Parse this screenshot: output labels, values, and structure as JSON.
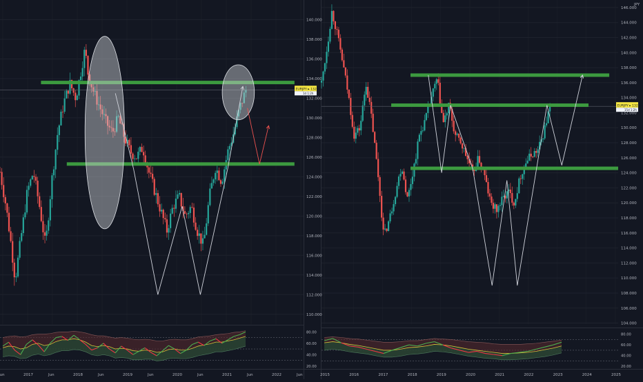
{
  "colors": {
    "background": "#131722",
    "grid": "#1e222d",
    "axis_text": "#b2b5be",
    "bull": "#26a69a",
    "bear": "#ef5350",
    "support_zone": "#3c9a3f",
    "pattern_line": "#d1d4dc",
    "ellipse_fill": "#cfd2d6",
    "price_badge": "#f5e642",
    "separator": "#2a2e39",
    "rsi_green": "#4caf50",
    "rsi_red": "#f23645",
    "rsi_ma_yellow": "#d9c23a",
    "band_fill_red": "#5a2a2e",
    "band_fill_green": "#1f4a33"
  },
  "chart_data": [
    {
      "type": "candlestick",
      "panel": "left",
      "currency_label": "",
      "y_ticks": [
        "140.000",
        "138.000",
        "136.000",
        "134.000",
        "132.000",
        "130.000",
        "128.000",
        "126.000",
        "124.000",
        "122.000",
        "120.000",
        "118.000",
        "116.000",
        "114.000",
        "112.000",
        "110.000"
      ],
      "x_ticks": [
        "Jun",
        "2017",
        "Jun",
        "2018",
        "Jun",
        "2019",
        "Jun",
        "2020",
        "Jun",
        "2021",
        "Jun",
        "2022",
        "Jun"
      ],
      "ylim": [
        109,
        142
      ],
      "price_label": {
        "text": "EURJPY ▸ 132.847",
        "sub": "1d 1:2h",
        "value": 132.85
      },
      "close_path": [
        [
          0.0,
          124.5
        ],
        [
          0.02,
          121.0
        ],
        [
          0.035,
          117.5
        ],
        [
          0.05,
          113.5
        ],
        [
          0.07,
          118.0
        ],
        [
          0.09,
          122.5
        ],
        [
          0.11,
          124.5
        ],
        [
          0.13,
          121.0
        ],
        [
          0.15,
          117.0
        ],
        [
          0.17,
          123.5
        ],
        [
          0.19,
          128.5
        ],
        [
          0.21,
          131.5
        ],
        [
          0.23,
          133.5
        ],
        [
          0.25,
          132.0
        ],
        [
          0.265,
          134.5
        ],
        [
          0.28,
          137.0
        ],
        [
          0.29,
          134.5
        ],
        [
          0.31,
          132.5
        ],
        [
          0.33,
          131.0
        ],
        [
          0.35,
          129.5
        ],
        [
          0.37,
          128.5
        ],
        [
          0.39,
          130.0
        ],
        [
          0.41,
          128.0
        ],
        [
          0.43,
          126.5
        ],
        [
          0.45,
          126.0
        ],
        [
          0.47,
          127.0
        ],
        [
          0.49,
          124.5
        ],
        [
          0.51,
          122.5
        ],
        [
          0.53,
          120.5
        ],
        [
          0.55,
          118.5
        ],
        [
          0.57,
          121.0
        ],
        [
          0.59,
          122.0
        ],
        [
          0.61,
          120.0
        ],
        [
          0.63,
          121.0
        ],
        [
          0.65,
          118.5
        ],
        [
          0.67,
          117.0
        ],
        [
          0.69,
          122.0
        ],
        [
          0.71,
          125.0
        ],
        [
          0.73,
          123.5
        ],
        [
          0.75,
          126.5
        ],
        [
          0.77,
          128.5
        ],
        [
          0.79,
          131.0
        ],
        [
          0.81,
          132.85
        ]
      ],
      "zones": [
        {
          "name": "resistance",
          "y": 133.6,
          "x0": 0.135,
          "x1": 0.97
        },
        {
          "name": "support",
          "y": 125.3,
          "x0": 0.22,
          "x1": 0.97
        }
      ],
      "w_pattern": [
        [
          0.38,
          132.5
        ],
        [
          0.44,
          124.8
        ],
        [
          0.52,
          112.0
        ],
        [
          0.6,
          121.0
        ],
        [
          0.66,
          112.0
        ],
        [
          0.75,
          124.8
        ],
        [
          0.8,
          133.2
        ]
      ],
      "projection": [
        [
          0.815,
          131.0
        ],
        [
          0.855,
          125.3
        ],
        [
          0.885,
          129.2
        ]
      ],
      "ellipses": [
        {
          "cx": 0.345,
          "cy": 128.5,
          "rx": 0.065,
          "ry": 9.8
        },
        {
          "cx": 0.785,
          "cy": 132.6,
          "rx": 0.053,
          "ry": 2.8
        }
      ]
    },
    {
      "type": "candlestick",
      "panel": "right",
      "currency_label": "JPY",
      "y_ticks": [
        "146.000",
        "144.000",
        "142.000",
        "140.000",
        "138.000",
        "136.000",
        "134.000",
        "132.000",
        "130.000",
        "128.000",
        "126.000",
        "124.000",
        "122.000",
        "120.000",
        "118.000",
        "116.000",
        "114.000",
        "112.000",
        "110.000",
        "108.000",
        "106.000",
        "104.000"
      ],
      "x_ticks": [
        "2015",
        "2016",
        "2017",
        "2018",
        "2019",
        "2020",
        "2021",
        "2022",
        "2023",
        "2024",
        "2025"
      ],
      "ylim": [
        103.5,
        147
      ],
      "price_label": {
        "text": "EURJPY ▸ 132.847",
        "sub": "15d 1:2h",
        "value": 132.85
      },
      "close_path": [
        [
          0.0,
          136.0
        ],
        [
          0.02,
          141.0
        ],
        [
          0.035,
          145.5
        ],
        [
          0.05,
          143.0
        ],
        [
          0.07,
          139.0
        ],
        [
          0.09,
          134.5
        ],
        [
          0.11,
          129.0
        ],
        [
          0.13,
          130.0
        ],
        [
          0.15,
          136.0
        ],
        [
          0.17,
          131.0
        ],
        [
          0.19,
          124.0
        ],
        [
          0.21,
          115.5
        ],
        [
          0.23,
          118.0
        ],
        [
          0.25,
          121.5
        ],
        [
          0.27,
          125.0
        ],
        [
          0.29,
          120.5
        ],
        [
          0.31,
          124.5
        ],
        [
          0.33,
          129.0
        ],
        [
          0.35,
          131.0
        ],
        [
          0.37,
          134.0
        ],
        [
          0.39,
          136.5
        ],
        [
          0.41,
          130.5
        ],
        [
          0.43,
          133.0
        ],
        [
          0.45,
          129.0
        ],
        [
          0.47,
          128.0
        ],
        [
          0.49,
          126.0
        ],
        [
          0.51,
          124.0
        ],
        [
          0.53,
          126.0
        ],
        [
          0.55,
          123.5
        ],
        [
          0.57,
          120.0
        ],
        [
          0.59,
          119.0
        ],
        [
          0.61,
          120.5
        ],
        [
          0.63,
          121.5
        ],
        [
          0.65,
          120.0
        ],
        [
          0.67,
          123.5
        ],
        [
          0.69,
          125.5
        ],
        [
          0.71,
          126.5
        ],
        [
          0.73,
          127.0
        ],
        [
          0.75,
          129.5
        ],
        [
          0.77,
          132.85
        ]
      ],
      "zones": [
        {
          "name": "upper-resistance",
          "y": 137.0,
          "x0": 0.3,
          "x1": 0.97
        },
        {
          "name": "resistance",
          "y": 133.0,
          "x0": 0.235,
          "x1": 0.9
        },
        {
          "name": "support",
          "y": 124.6,
          "x0": 0.3,
          "x1": 1.0
        }
      ],
      "w_pattern": [
        [
          0.36,
          137.0
        ],
        [
          0.405,
          124.0
        ],
        [
          0.435,
          133.0
        ],
        [
          0.51,
          124.5
        ],
        [
          0.575,
          109.0
        ],
        [
          0.625,
          123.0
        ],
        [
          0.66,
          109.0
        ],
        [
          0.76,
          133.0
        ],
        [
          0.81,
          125.0
        ],
        [
          0.88,
          137.0
        ]
      ]
    },
    {
      "type": "line",
      "panel": "left-rsi",
      "y_ticks": [
        "80.00",
        "60.00",
        "40.00",
        "20.00"
      ],
      "ylim": [
        15,
        90
      ],
      "levels": [
        70,
        50,
        30
      ],
      "rsi": [
        55,
        62,
        48,
        40,
        58,
        66,
        57,
        45,
        60,
        70,
        72,
        65,
        74,
        66,
        58,
        48,
        52,
        60,
        50,
        43,
        55,
        48,
        40,
        46,
        52,
        44,
        38,
        47,
        56,
        50,
        42,
        48,
        58,
        62,
        56,
        64,
        68,
        60,
        66,
        72,
        75,
        80
      ],
      "rsi_ma": [
        52,
        55,
        54,
        50,
        52,
        58,
        60,
        56,
        58,
        63,
        66,
        66,
        68,
        66,
        62,
        56,
        54,
        56,
        54,
        50,
        51,
        50,
        47,
        46,
        48,
        47,
        44,
        45,
        49,
        50,
        48,
        48,
        51,
        55,
        57,
        59,
        62,
        62,
        64,
        66,
        69,
        72
      ],
      "band_upper": [
        70,
        72,
        73,
        71,
        72,
        75,
        76,
        76,
        77,
        79,
        80,
        80,
        81,
        80,
        78,
        75,
        73,
        73,
        71,
        69,
        70,
        69,
        67,
        66,
        67,
        66,
        64,
        64,
        66,
        67,
        66,
        66,
        68,
        71,
        72,
        73,
        75,
        76,
        77,
        79,
        80,
        82
      ],
      "band_lower": [
        36,
        38,
        37,
        33,
        34,
        39,
        41,
        38,
        40,
        44,
        47,
        47,
        49,
        48,
        45,
        40,
        38,
        40,
        38,
        34,
        35,
        34,
        31,
        31,
        32,
        32,
        29,
        30,
        33,
        34,
        33,
        33,
        35,
        38,
        40,
        42,
        45,
        45,
        47,
        49,
        52,
        55
      ]
    },
    {
      "type": "line",
      "panel": "right-rsi",
      "y_ticks": [
        "80.00",
        "60.00",
        "40.00",
        "20.00"
      ],
      "ylim": [
        15,
        90
      ],
      "levels": [
        70,
        50,
        30
      ],
      "rsi": [
        68,
        72,
        64,
        58,
        56,
        52,
        48,
        44,
        50,
        55,
        60,
        58,
        63,
        66,
        60,
        54,
        50,
        46,
        48,
        44,
        42,
        40,
        44,
        46,
        48,
        52,
        56,
        60,
        65
      ],
      "rsi_ma": [
        64,
        66,
        64,
        61,
        59,
        56,
        53,
        50,
        50,
        52,
        55,
        56,
        58,
        61,
        60,
        58,
        55,
        52,
        50,
        48,
        46,
        44,
        44,
        45,
        46,
        48,
        51,
        54,
        58
      ],
      "band_upper": [
        74,
        75,
        74,
        72,
        71,
        69,
        67,
        65,
        65,
        66,
        68,
        68,
        70,
        72,
        71,
        70,
        68,
        66,
        65,
        64,
        62,
        61,
        61,
        61,
        62,
        63,
        65,
        67,
        69
      ],
      "band_lower": [
        50,
        52,
        50,
        47,
        45,
        43,
        40,
        37,
        37,
        39,
        42,
        43,
        45,
        48,
        47,
        45,
        42,
        39,
        37,
        35,
        34,
        32,
        32,
        33,
        34,
        36,
        38,
        41,
        45
      ]
    }
  ]
}
